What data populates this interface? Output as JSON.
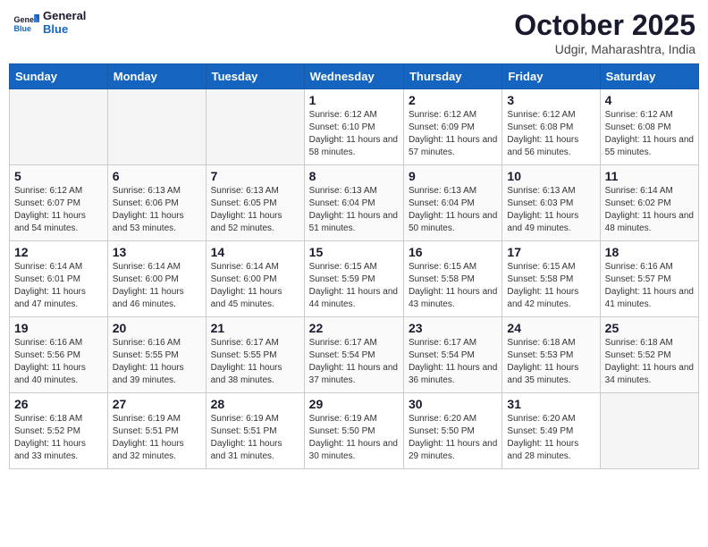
{
  "header": {
    "logo": "General Blue",
    "month": "October 2025",
    "location": "Udgir, Maharashtra, India"
  },
  "days_of_week": [
    "Sunday",
    "Monday",
    "Tuesday",
    "Wednesday",
    "Thursday",
    "Friday",
    "Saturday"
  ],
  "weeks": [
    [
      {
        "day": "",
        "info": ""
      },
      {
        "day": "",
        "info": ""
      },
      {
        "day": "",
        "info": ""
      },
      {
        "day": "1",
        "info": "Sunrise: 6:12 AM\nSunset: 6:10 PM\nDaylight: 11 hours\nand 58 minutes."
      },
      {
        "day": "2",
        "info": "Sunrise: 6:12 AM\nSunset: 6:09 PM\nDaylight: 11 hours\nand 57 minutes."
      },
      {
        "day": "3",
        "info": "Sunrise: 6:12 AM\nSunset: 6:08 PM\nDaylight: 11 hours\nand 56 minutes."
      },
      {
        "day": "4",
        "info": "Sunrise: 6:12 AM\nSunset: 6:08 PM\nDaylight: 11 hours\nand 55 minutes."
      }
    ],
    [
      {
        "day": "5",
        "info": "Sunrise: 6:12 AM\nSunset: 6:07 PM\nDaylight: 11 hours\nand 54 minutes."
      },
      {
        "day": "6",
        "info": "Sunrise: 6:13 AM\nSunset: 6:06 PM\nDaylight: 11 hours\nand 53 minutes."
      },
      {
        "day": "7",
        "info": "Sunrise: 6:13 AM\nSunset: 6:05 PM\nDaylight: 11 hours\nand 52 minutes."
      },
      {
        "day": "8",
        "info": "Sunrise: 6:13 AM\nSunset: 6:04 PM\nDaylight: 11 hours\nand 51 minutes."
      },
      {
        "day": "9",
        "info": "Sunrise: 6:13 AM\nSunset: 6:04 PM\nDaylight: 11 hours\nand 50 minutes."
      },
      {
        "day": "10",
        "info": "Sunrise: 6:13 AM\nSunset: 6:03 PM\nDaylight: 11 hours\nand 49 minutes."
      },
      {
        "day": "11",
        "info": "Sunrise: 6:14 AM\nSunset: 6:02 PM\nDaylight: 11 hours\nand 48 minutes."
      }
    ],
    [
      {
        "day": "12",
        "info": "Sunrise: 6:14 AM\nSunset: 6:01 PM\nDaylight: 11 hours\nand 47 minutes."
      },
      {
        "day": "13",
        "info": "Sunrise: 6:14 AM\nSunset: 6:00 PM\nDaylight: 11 hours\nand 46 minutes."
      },
      {
        "day": "14",
        "info": "Sunrise: 6:14 AM\nSunset: 6:00 PM\nDaylight: 11 hours\nand 45 minutes."
      },
      {
        "day": "15",
        "info": "Sunrise: 6:15 AM\nSunset: 5:59 PM\nDaylight: 11 hours\nand 44 minutes."
      },
      {
        "day": "16",
        "info": "Sunrise: 6:15 AM\nSunset: 5:58 PM\nDaylight: 11 hours\nand 43 minutes."
      },
      {
        "day": "17",
        "info": "Sunrise: 6:15 AM\nSunset: 5:58 PM\nDaylight: 11 hours\nand 42 minutes."
      },
      {
        "day": "18",
        "info": "Sunrise: 6:16 AM\nSunset: 5:57 PM\nDaylight: 11 hours\nand 41 minutes."
      }
    ],
    [
      {
        "day": "19",
        "info": "Sunrise: 6:16 AM\nSunset: 5:56 PM\nDaylight: 11 hours\nand 40 minutes."
      },
      {
        "day": "20",
        "info": "Sunrise: 6:16 AM\nSunset: 5:55 PM\nDaylight: 11 hours\nand 39 minutes."
      },
      {
        "day": "21",
        "info": "Sunrise: 6:17 AM\nSunset: 5:55 PM\nDaylight: 11 hours\nand 38 minutes."
      },
      {
        "day": "22",
        "info": "Sunrise: 6:17 AM\nSunset: 5:54 PM\nDaylight: 11 hours\nand 37 minutes."
      },
      {
        "day": "23",
        "info": "Sunrise: 6:17 AM\nSunset: 5:54 PM\nDaylight: 11 hours\nand 36 minutes."
      },
      {
        "day": "24",
        "info": "Sunrise: 6:18 AM\nSunset: 5:53 PM\nDaylight: 11 hours\nand 35 minutes."
      },
      {
        "day": "25",
        "info": "Sunrise: 6:18 AM\nSunset: 5:52 PM\nDaylight: 11 hours\nand 34 minutes."
      }
    ],
    [
      {
        "day": "26",
        "info": "Sunrise: 6:18 AM\nSunset: 5:52 PM\nDaylight: 11 hours\nand 33 minutes."
      },
      {
        "day": "27",
        "info": "Sunrise: 6:19 AM\nSunset: 5:51 PM\nDaylight: 11 hours\nand 32 minutes."
      },
      {
        "day": "28",
        "info": "Sunrise: 6:19 AM\nSunset: 5:51 PM\nDaylight: 11 hours\nand 31 minutes."
      },
      {
        "day": "29",
        "info": "Sunrise: 6:19 AM\nSunset: 5:50 PM\nDaylight: 11 hours\nand 30 minutes."
      },
      {
        "day": "30",
        "info": "Sunrise: 6:20 AM\nSunset: 5:50 PM\nDaylight: 11 hours\nand 29 minutes."
      },
      {
        "day": "31",
        "info": "Sunrise: 6:20 AM\nSunset: 5:49 PM\nDaylight: 11 hours\nand 28 minutes."
      },
      {
        "day": "",
        "info": ""
      }
    ]
  ]
}
